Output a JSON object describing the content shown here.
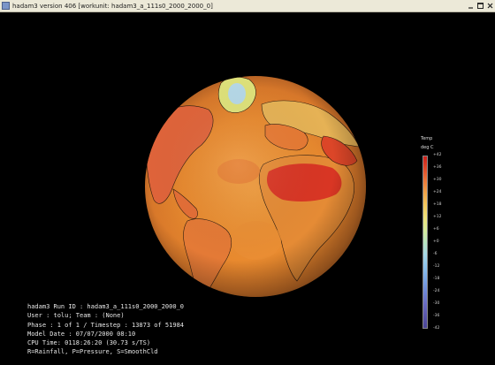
{
  "window": {
    "title": "hadam3 version 406 [workunit: hadam3_a_111s0_2000_2000_0]",
    "controls": {
      "minimize": "minimize",
      "maximize": "maximize",
      "close": "close"
    }
  },
  "legend": {
    "title": "Temp",
    "unit": "deg C",
    "labels": [
      "+42",
      "+36",
      "+30",
      "+24",
      "+18",
      "+12",
      "+6",
      "+0",
      "-6",
      "-12",
      "-18",
      "-24",
      "-30",
      "-36",
      "-42"
    ],
    "colors": [
      "#cc1f1a",
      "#e04a2a",
      "#ee7a3a",
      "#f2a649",
      "#f4c95d",
      "#eee27a",
      "#d8ec9a",
      "#b9e6c0",
      "#a5d8e6",
      "#8cc3ec",
      "#7aa7e6",
      "#6e88d8",
      "#6a6cc4",
      "#5a56ac",
      "#4a4496"
    ]
  },
  "info": {
    "lines": [
      "hadam3 Run ID : hadam3_a_111s0_2000_2000_0",
      "User : tolu; Team : (None)",
      "Phase : 1 of 1  /  Timestep : 13873 of 51984",
      "Model Date : 07/07/2000 08:10",
      "CPU Time: 0118:26:20  (30.73 s/TS)",
      "R=Rainfall, P=Pressure, S=SmoothCld"
    ]
  },
  "globe": {
    "ocean_color": "#e6892f",
    "land_warm_color": "#e14b2a",
    "ice_color": "#b6d9e8"
  }
}
